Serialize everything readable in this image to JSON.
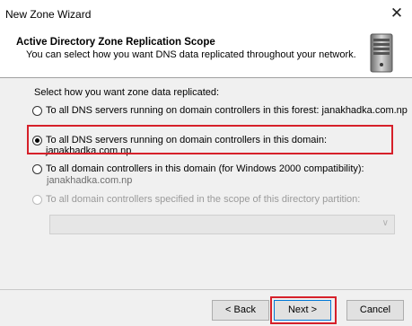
{
  "window": {
    "title": "New Zone Wizard",
    "close_glyph": "✕"
  },
  "header": {
    "title": "Active Directory Zone Replication Scope",
    "subtitle": "You can select how you want DNS data replicated throughout your network."
  },
  "body": {
    "prompt": "Select how you want zone data replicated:",
    "options": [
      {
        "label": "To all DNS servers running on domain controllers in this forest: janakhadka.com.np",
        "checked": false,
        "enabled": true
      },
      {
        "label": "To all DNS servers running on domain controllers in this domain: janakhadka.com.np",
        "checked": true,
        "enabled": true
      },
      {
        "label": "To all domain controllers in this domain (for Windows 2000 compatibility):",
        "sub": "janakhadka.com.np",
        "checked": false,
        "enabled": true
      },
      {
        "label": "To all domain controllers specified in the scope of this directory partition:",
        "checked": false,
        "enabled": false
      }
    ],
    "partition_value": ""
  },
  "buttons": {
    "back": "< Back",
    "next": "Next >",
    "cancel": "Cancel"
  },
  "colors": {
    "highlight": "#d6202a",
    "accent": "#0078d7"
  }
}
